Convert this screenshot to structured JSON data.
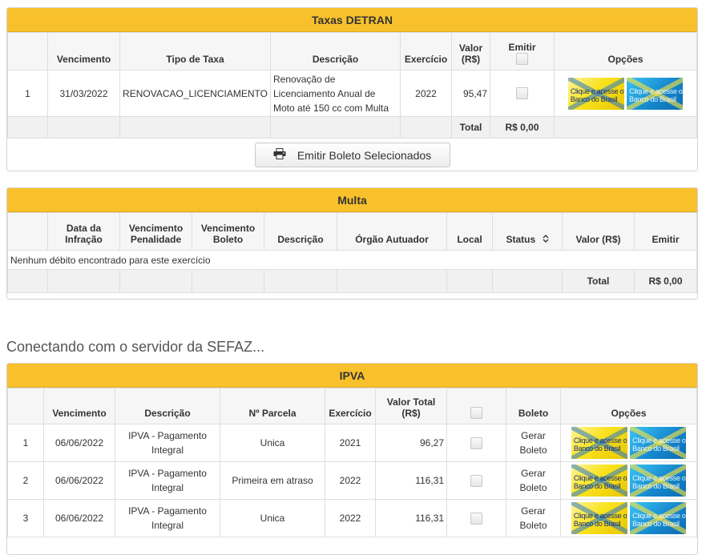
{
  "taxas": {
    "title": "Taxas DETRAN",
    "headers": [
      "",
      "Vencimento",
      "Tipo de Taxa",
      "Descrição",
      "Exercício",
      "Valor (R$)",
      "Emitir",
      "Opções"
    ],
    "rows": [
      {
        "n": "1",
        "vencimento": "31/03/2022",
        "tipo": "RENOVACAO_LICENCIAMENTO",
        "descricao": "Renovação de Licenciamento Anual de Moto até 150 cc com Multa",
        "exercicio": "2022",
        "valor": "95,47"
      }
    ],
    "total_label": "Total",
    "total_value": "R$ 0,00",
    "emit_button": "Emitir Boleto Selecionados"
  },
  "multa": {
    "title": "Multa",
    "headers": [
      "",
      "Data da Infração",
      "Vencimento Penalidade",
      "Vencimento Boleto",
      "Descrição",
      "Órgão Autuador",
      "Local",
      "Status",
      "Valor (R$)",
      "Emitir"
    ],
    "empty_message": "Nenhum débito encontrado para este exercício",
    "total_label": "Total",
    "total_value": "R$ 0,00"
  },
  "status_message": "Conectando com o servidor da SEFAZ...",
  "ipva": {
    "title": "IPVA",
    "headers": [
      "",
      "Vencimento",
      "Descrição",
      "Nº Parcela",
      "Exercício",
      "Valor Total (R$)",
      "",
      "Boleto",
      "Opções"
    ],
    "rows": [
      {
        "n": "1",
        "vencimento": "06/06/2022",
        "descricao": "IPVA - Pagamento Integral",
        "parcela": "Unica",
        "exercicio": "2021",
        "valor": "96,27",
        "boleto": "Gerar Boleto"
      },
      {
        "n": "2",
        "vencimento": "06/06/2022",
        "descricao": "IPVA - Pagamento Integral",
        "parcela": "Primeira em atraso",
        "exercicio": "2022",
        "valor": "116,31",
        "boleto": "Gerar Boleto"
      },
      {
        "n": "3",
        "vencimento": "06/06/2022",
        "descricao": "IPVA - Pagamento Integral",
        "parcela": "Unica",
        "exercicio": "2022",
        "valor": "116,31",
        "boleto": "Gerar Boleto"
      }
    ]
  },
  "bb_banner_text": "Clique e acesse o Banco do Brasil",
  "icons": {
    "print": "printer-icon",
    "sort": "sort-icon"
  },
  "colors": {
    "panel_header": "#f8c12c"
  }
}
